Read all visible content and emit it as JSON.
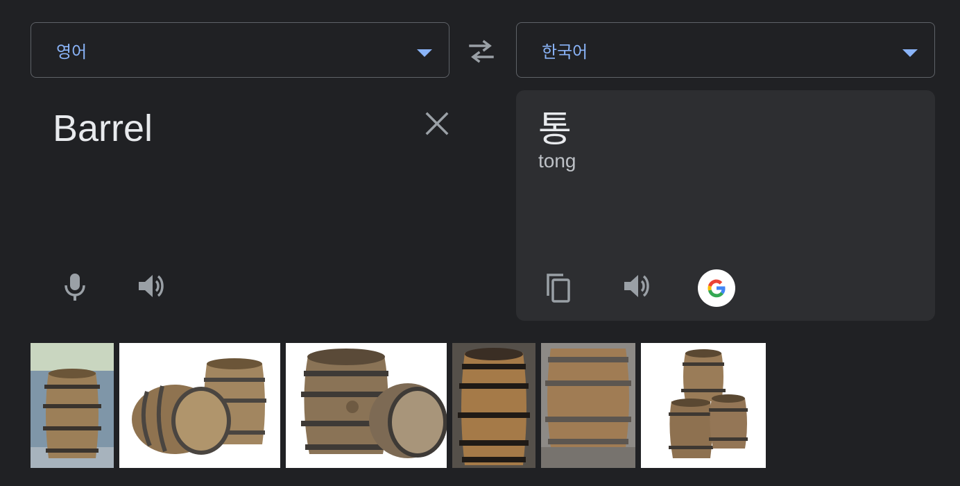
{
  "source": {
    "language": "영어",
    "text": "Barrel"
  },
  "target": {
    "language": "한국어",
    "text": "통",
    "romanization": "tong"
  },
  "icons": {
    "dropdown": "chevron-down-icon",
    "swap": "swap-icon",
    "clear": "close-icon",
    "mic": "microphone-icon",
    "listen": "speaker-icon",
    "copy": "copy-icon",
    "google": "google-logo-icon"
  },
  "colors": {
    "background": "#202124",
    "accent": "#8ab4f8",
    "panel": "#2d2e31",
    "text": "#e8eaed",
    "icon": "#9aa0a6"
  },
  "images": {
    "count": 6,
    "subject": "barrel"
  }
}
